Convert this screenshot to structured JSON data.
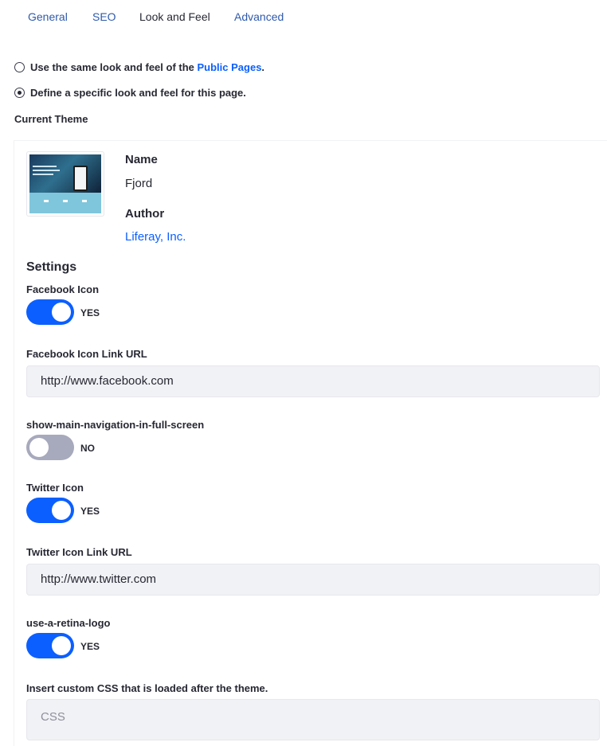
{
  "tabs": [
    {
      "label": "General"
    },
    {
      "label": "SEO"
    },
    {
      "label": "Look and Feel"
    },
    {
      "label": "Advanced"
    }
  ],
  "look_and_feel": {
    "option_same": {
      "text": "Use the same look and feel of the ",
      "link": "Public Pages",
      "suffix": ".",
      "selected": false
    },
    "option_specific": {
      "text": "Define a specific look and feel for this page.",
      "selected": true
    },
    "current_theme_label": "Current Theme"
  },
  "theme": {
    "name_label": "Name",
    "name": "Fjord",
    "author_label": "Author",
    "author": "Liferay, Inc."
  },
  "settings": {
    "title": "Settings",
    "facebook_icon": {
      "label": "Facebook Icon",
      "state": "YES",
      "on": true
    },
    "facebook_url": {
      "label": "Facebook Icon Link URL",
      "value": "http://www.facebook.com"
    },
    "show_main_nav": {
      "label": "show-main-navigation-in-full-screen",
      "state": "NO",
      "on": false
    },
    "twitter_icon": {
      "label": "Twitter Icon",
      "state": "YES",
      "on": true
    },
    "twitter_url": {
      "label": "Twitter Icon Link URL",
      "value": "http://www.twitter.com"
    },
    "retina_logo": {
      "label": "use-a-retina-logo",
      "state": "YES",
      "on": true
    },
    "custom_css": {
      "label": "Insert custom CSS that is loaded after the theme.",
      "placeholder": "CSS"
    }
  },
  "colors": {
    "accent": "#0b5fff",
    "link": "#2e5aac",
    "toggle_off": "#a7a9bc",
    "input_bg": "#f1f2f5"
  }
}
